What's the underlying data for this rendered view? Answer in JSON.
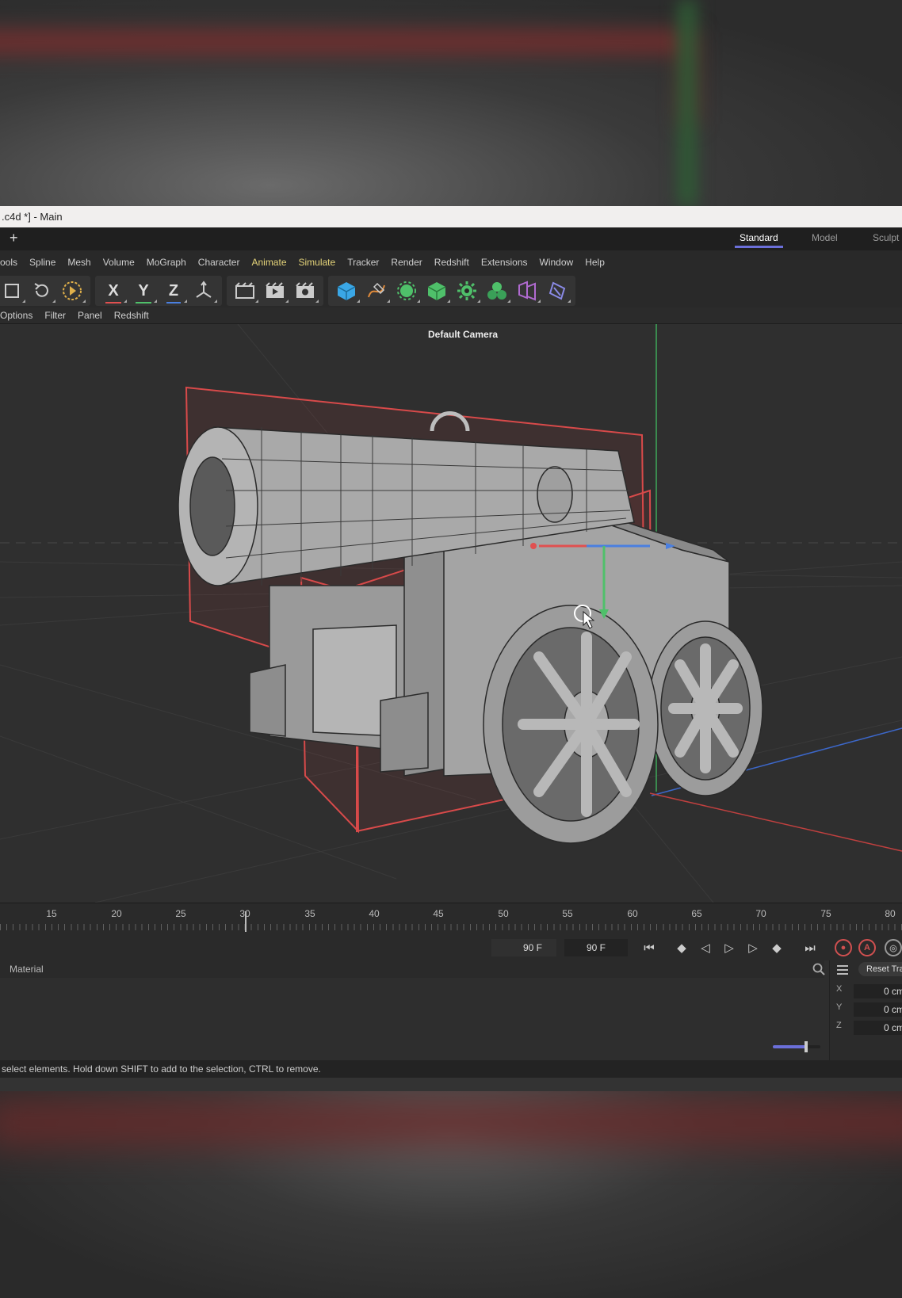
{
  "window": {
    "title": ".c4d *] - Main"
  },
  "layouts": {
    "tabs": [
      "Standard",
      "Model",
      "Sculpt"
    ],
    "active": "Standard"
  },
  "menu": [
    "ools",
    "Spline",
    "Mesh",
    "Volume",
    "MoGraph",
    "Character",
    "Animate",
    "Simulate",
    "Tracker",
    "Render",
    "Redshift",
    "Extensions",
    "Window",
    "Help"
  ],
  "viewport_menu": [
    "Options",
    "Filter",
    "Panel",
    "Redshift"
  ],
  "toolbar": {
    "axis_x": "X",
    "axis_y": "Y",
    "axis_z": "Z",
    "icons": [
      "select-tool-icon",
      "undo-icon",
      "live-select-icon",
      "render-view-icon",
      "render-picture-queue-icon",
      "render-settings-icon",
      "cube-primitive-icon",
      "pen-spline-icon",
      "subdivision-icon",
      "extrude-icon",
      "deformer-icon",
      "mograph-cloner-icon",
      "field-icon",
      "tag-icon"
    ]
  },
  "viewport": {
    "camera": "Default Camera"
  },
  "timeline": {
    "ticks": [
      "15",
      "20",
      "25",
      "30",
      "35",
      "40",
      "45",
      "50",
      "55",
      "60",
      "65",
      "70",
      "75",
      "80"
    ],
    "end_frame": "90 F",
    "current_frame": "90 F"
  },
  "material_panel": {
    "title": "Material"
  },
  "coordinates": {
    "reset_label": "Reset Tra",
    "x_label": "X",
    "x_value": "0 cm",
    "y_label": "Y",
    "y_value": "0 cm",
    "z_label": "Z",
    "z_value": "0 cm"
  },
  "status": {
    "text": "select elements. Hold down SHIFT to add to the selection, CTRL to remove."
  },
  "colors": {
    "accent": "#6b6fd9",
    "highlight_menu": "#e6d57a",
    "x_axis": "#e05050",
    "y_axis": "#4fc06a",
    "z_axis": "#4a7fe0"
  }
}
